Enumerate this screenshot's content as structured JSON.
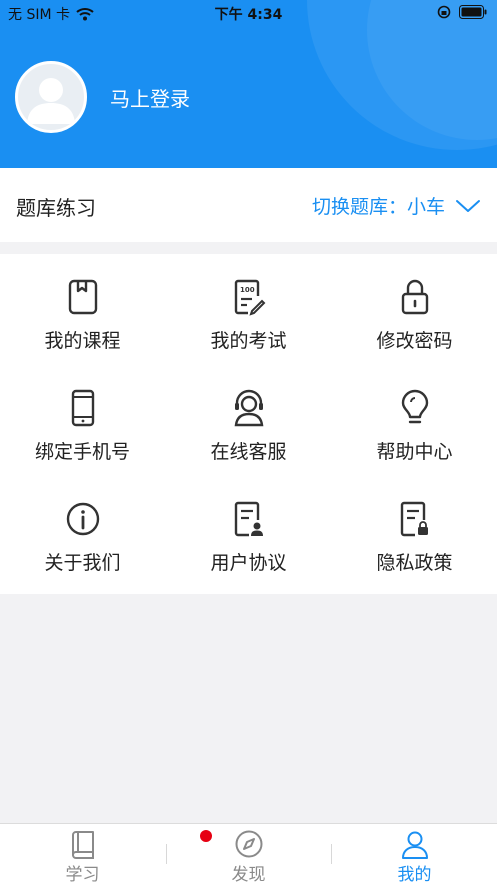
{
  "status_bar": {
    "carrier": "无 SIM 卡",
    "time": "下午 4:34"
  },
  "profile": {
    "login_label": "马上登录"
  },
  "question_bank": {
    "title": "题库练习",
    "switch_label": "切换题库：小车"
  },
  "menu": {
    "items": [
      {
        "label": "我的课程",
        "icon": "course-book-icon"
      },
      {
        "label": "我的考试",
        "icon": "exam-100-icon"
      },
      {
        "label": "修改密码",
        "icon": "lock-icon"
      },
      {
        "label": "绑定手机号",
        "icon": "phone-icon"
      },
      {
        "label": "在线客服",
        "icon": "headset-service-icon"
      },
      {
        "label": "帮助中心",
        "icon": "lightbulb-icon"
      },
      {
        "label": "关于我们",
        "icon": "info-icon"
      },
      {
        "label": "用户协议",
        "icon": "document-user-icon"
      },
      {
        "label": "隐私政策",
        "icon": "document-lock-icon"
      }
    ]
  },
  "tabbar": {
    "tabs": [
      {
        "label": "学习",
        "icon": "book-icon",
        "active": false
      },
      {
        "label": "发现",
        "icon": "compass-icon",
        "active": false,
        "badge_dot": true
      },
      {
        "label": "我的",
        "icon": "person-icon",
        "active": true
      }
    ]
  },
  "colors": {
    "brand": "#1a8ff2",
    "badge": "#e60012",
    "background": "#f2f2f4"
  }
}
